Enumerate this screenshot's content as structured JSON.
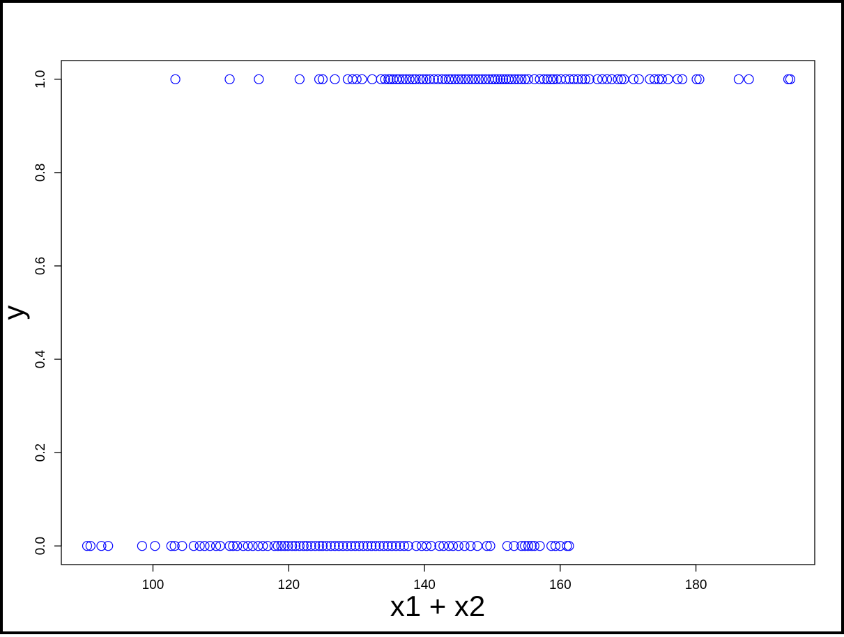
{
  "chart_data": {
    "type": "scatter",
    "xlabel": "x1 + x2",
    "ylabel": "y",
    "xlim": [
      86.5,
      197.5
    ],
    "ylim": [
      -0.04,
      1.04
    ],
    "xticks": [
      100,
      120,
      140,
      160,
      180
    ],
    "yticks": [
      0.0,
      0.2,
      0.4,
      0.6,
      0.8,
      1.0
    ],
    "xtick_labels": [
      "100",
      "120",
      "140",
      "160",
      "180"
    ],
    "ytick_labels": [
      "0.0",
      "0.2",
      "0.4",
      "0.6",
      "0.8",
      "1.0"
    ],
    "grid": false,
    "marker": "open-circle",
    "color": "#0000ff",
    "series": [
      {
        "y": 1,
        "x": [
          103.3,
          111.3,
          115.6,
          121.6,
          124.5,
          125.0,
          126.8,
          128.7,
          129.4,
          130.0,
          130.8,
          132.3,
          133.6,
          134.2,
          134.7,
          135.0,
          135.4,
          135.9,
          136.3,
          136.8,
          137.3,
          137.8,
          138.3,
          138.7,
          139.3,
          139.8,
          140.3,
          140.8,
          141.4,
          142.0,
          142.6,
          143.1,
          143.6,
          144.0,
          144.5,
          145.0,
          145.5,
          146.0,
          146.5,
          147.0,
          147.5,
          148.0,
          148.5,
          149.0,
          149.5,
          150.0,
          150.4,
          150.8,
          151.2,
          151.6,
          152.0,
          152.4,
          152.8,
          153.3,
          153.8,
          154.3,
          154.8,
          155.3,
          156.2,
          157.0,
          157.6,
          158.1,
          158.6,
          159.0,
          159.5,
          160.1,
          160.8,
          161.4,
          162.0,
          162.6,
          163.2,
          163.7,
          164.3,
          165.5,
          166.2,
          166.9,
          167.6,
          168.5,
          169.0,
          169.4,
          170.8,
          171.6,
          173.2,
          173.9,
          174.5,
          175.0,
          175.9,
          177.3,
          178.0,
          180.1,
          180.5,
          186.3,
          187.8,
          193.6,
          193.9
        ]
      },
      {
        "y": 0,
        "x": [
          90.3,
          90.8,
          92.4,
          93.4,
          98.4,
          100.3,
          102.7,
          103.2,
          104.3,
          106.0,
          106.9,
          107.6,
          108.4,
          109.3,
          109.9,
          111.3,
          111.8,
          112.4,
          113.3,
          114.0,
          114.7,
          115.5,
          116.2,
          116.9,
          117.9,
          118.4,
          118.9,
          119.4,
          119.9,
          120.5,
          121.0,
          121.6,
          122.2,
          122.7,
          123.3,
          123.9,
          124.5,
          125.0,
          125.6,
          126.2,
          126.8,
          127.4,
          128.0,
          128.6,
          129.2,
          129.8,
          130.4,
          131.0,
          131.6,
          132.2,
          132.8,
          133.4,
          134.0,
          134.6,
          135.2,
          135.8,
          136.4,
          137.0,
          137.6,
          138.8,
          139.6,
          140.3,
          141.0,
          142.2,
          142.8,
          143.6,
          144.2,
          145.0,
          145.9,
          146.8,
          147.8,
          149.2,
          149.7,
          152.2,
          153.2,
          154.3,
          154.8,
          155.3,
          155.8,
          156.2,
          157.0,
          158.7,
          159.3,
          160.0,
          161.0,
          161.3
        ]
      }
    ]
  }
}
